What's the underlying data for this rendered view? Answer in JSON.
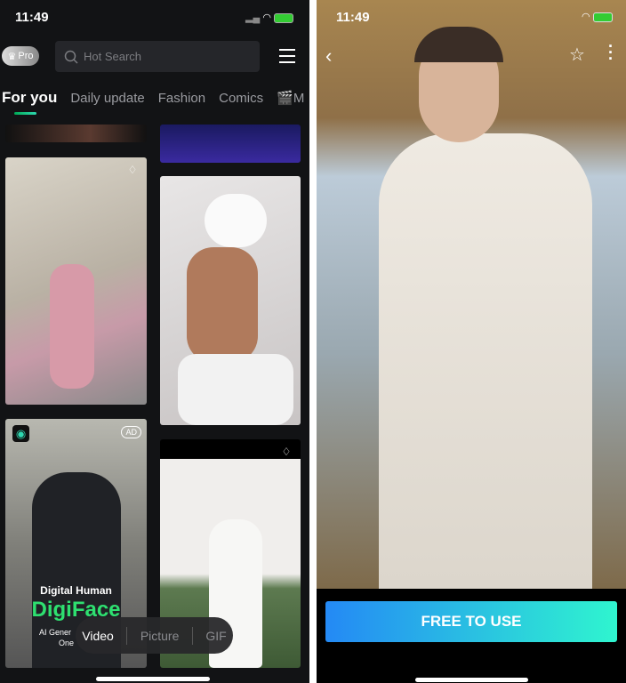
{
  "feed": {
    "status": {
      "time": "11:49"
    },
    "pro_label": "Pro",
    "search": {
      "placeholder": "Hot Search"
    },
    "tabs": [
      {
        "label": "For you"
      },
      {
        "label": "Daily update"
      },
      {
        "label": "Fashion"
      },
      {
        "label": "Comics"
      },
      {
        "label": "M"
      }
    ],
    "ad": {
      "badge": "AD",
      "subtitle": "Digital Human",
      "brand": "DigiFace",
      "tagline_1": "AI Gener",
      "tagline_2": "One"
    },
    "media_filter": [
      {
        "label": "Video"
      },
      {
        "label": "Picture"
      },
      {
        "label": "GIF"
      }
    ],
    "accent": "#2ed8b0"
  },
  "detail": {
    "status": {
      "time": "11:49"
    },
    "cta_label": "FREE TO USE",
    "cta_gradient": [
      "#2489f5",
      "#2ff5cf"
    ]
  }
}
